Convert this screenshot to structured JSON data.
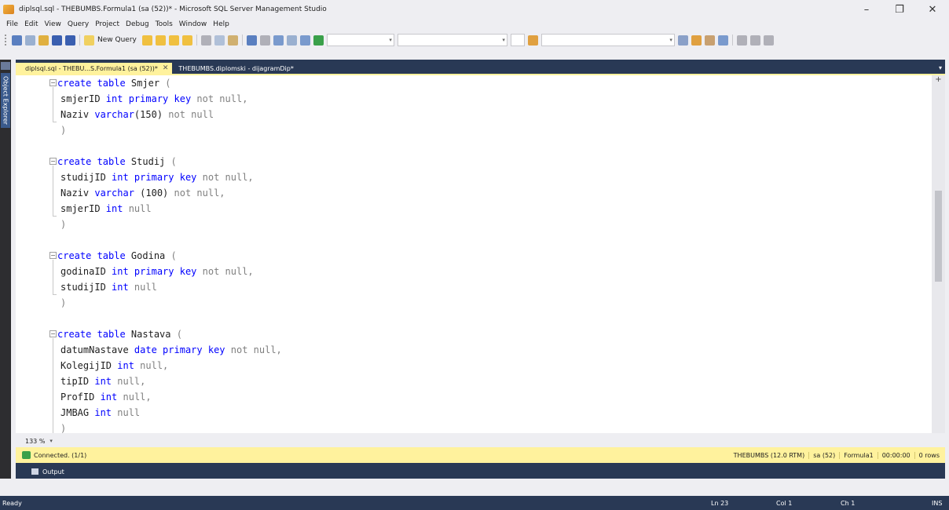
{
  "window": {
    "title": "diplsql.sql - THEBUMBS.Formula1 (sa (52))* - Microsoft SQL Server Management Studio",
    "minimize": "–",
    "restore": "❐",
    "close": "✕"
  },
  "menu": [
    "File",
    "Edit",
    "View",
    "Query",
    "Project",
    "Debug",
    "Tools",
    "Window",
    "Help"
  ],
  "toolbar": {
    "new_query_label": "New Query"
  },
  "left_panel": {
    "object_explorer_label": "Object Explorer"
  },
  "tabs": {
    "active": "diplsql.sql - THEBU...S.Formula1 (sa (52))*",
    "active_close": "✕",
    "inactive": "THEBUMBS.diplomski - dijagramDip*",
    "menu_arrow": "▾"
  },
  "code": {
    "smjer": {
      "l1_kw": "create table",
      "l1_name": " Smjer",
      "l1_paren": " (",
      "l2_id": "smjerID",
      "l2_type": " int primary key",
      "l2_rest": " not null,",
      "l3_id": "Naziv",
      "l3_type": " varchar",
      "l3_rest": "(150)",
      "l3_end": " not null",
      "close": ")"
    },
    "studij": {
      "l1_kw": "create table",
      "l1_name": " Studij",
      "l1_paren": " (",
      "l2_id": "studijID",
      "l2_type": " int primary key",
      "l2_rest": " not null,",
      "l3_id": "Naziv",
      "l3_type": " varchar",
      "l3_paren": " (100)",
      "l3_rest": " not null,",
      "l4_id": "smjerID",
      "l4_type": " int",
      "l4_rest": " null",
      "close": ")"
    },
    "godina": {
      "l1_kw": "create table",
      "l1_name": " Godina",
      "l1_paren": " (",
      "l2_id": "godinaID",
      "l2_type": " int primary key",
      "l2_rest": " not null,",
      "l3_id": "studijID",
      "l3_type": " int",
      "l3_rest": " null",
      "close": ")"
    },
    "nastava": {
      "l1_kw": "create table",
      "l1_name": " Nastava",
      "l1_paren": " (",
      "l2_id": "datumNastave",
      "l2_type": " date primary key",
      "l2_rest": " not null,",
      "l3_id": "KolegijID",
      "l3_type": " int",
      "l3_rest": " null,",
      "l4_id": "tipID",
      "l4_type": " int",
      "l4_rest": " null,",
      "l5_id": "ProfID",
      "l5_type": " int",
      "l5_rest": " null,",
      "l6_id": "JMBAG",
      "l6_type": " int",
      "l6_rest": " null",
      "close": ")"
    }
  },
  "editor": {
    "zoom": "133 %",
    "zoom_arrow": "▾"
  },
  "connection": {
    "status": "Connected. (1/1)",
    "server": "THEBUMBS (12.0 RTM)",
    "user": "sa (52)",
    "database": "Formula1",
    "time": "00:00:00",
    "rows": "0 rows"
  },
  "output": {
    "label": "Output"
  },
  "statusbar": {
    "ready": "Ready",
    "ln": "Ln 23",
    "col": "Col 1",
    "ch": "Ch 1",
    "ins": "INS"
  }
}
